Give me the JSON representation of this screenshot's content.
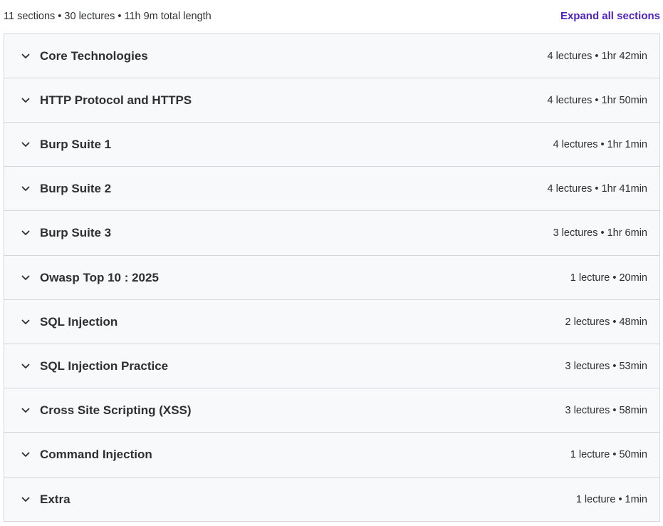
{
  "summary": {
    "text": "11 sections • 30 lectures • 11h 9m total length",
    "expand_label": "Expand all sections"
  },
  "colors": {
    "accent": "#5022c3",
    "section_bg": "#f7f9fa",
    "border": "#d1d7dc",
    "text": "#2d2f31"
  },
  "icons": {
    "section_toggle": "chevron-down-icon"
  },
  "sections": [
    {
      "title": "Core Technologies",
      "meta": "4 lectures • 1hr 42min"
    },
    {
      "title": "HTTP Protocol and HTTPS",
      "meta": "4 lectures • 1hr 50min"
    },
    {
      "title": "Burp Suite 1",
      "meta": "4 lectures • 1hr 1min"
    },
    {
      "title": "Burp Suite 2",
      "meta": "4 lectures • 1hr 41min"
    },
    {
      "title": "Burp Suite 3",
      "meta": "3 lectures • 1hr 6min"
    },
    {
      "title": "Owasp Top 10 : 2025",
      "meta": "1 lecture • 20min"
    },
    {
      "title": "SQL Injection",
      "meta": "2 lectures • 48min"
    },
    {
      "title": "SQL Injection Practice",
      "meta": "3 lectures • 53min"
    },
    {
      "title": "Cross Site Scripting (XSS)",
      "meta": "3 lectures • 58min"
    },
    {
      "title": "Command Injection",
      "meta": "1 lecture • 50min"
    },
    {
      "title": "Extra",
      "meta": "1 lecture • 1min"
    }
  ]
}
